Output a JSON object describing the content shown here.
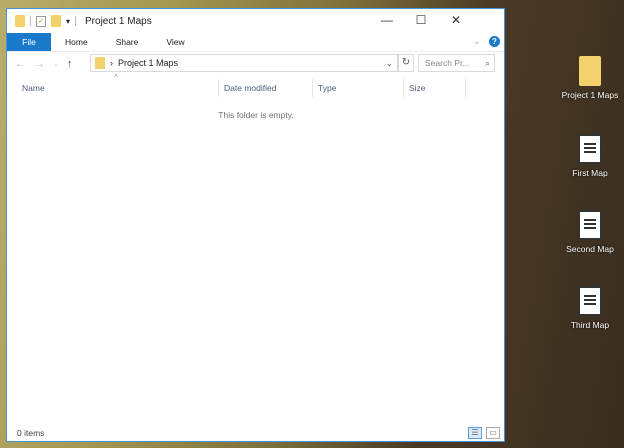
{
  "window": {
    "title": "Project 1 Maps"
  },
  "ribbon": {
    "tabs": [
      "File",
      "Home",
      "Share",
      "View"
    ]
  },
  "address": {
    "path": "Project 1 Maps",
    "search_placeholder": "Search Pr..."
  },
  "columns": [
    "Name",
    "Date modified",
    "Type",
    "Size"
  ],
  "empty_message": "This folder is empty.",
  "status": {
    "items": "0 items"
  },
  "desktop": [
    {
      "label": "Project 1 Maps",
      "type": "folder"
    },
    {
      "label": "First Map",
      "type": "document"
    },
    {
      "label": "Second Map",
      "type": "document"
    },
    {
      "label": "Third Map",
      "type": "document"
    }
  ]
}
